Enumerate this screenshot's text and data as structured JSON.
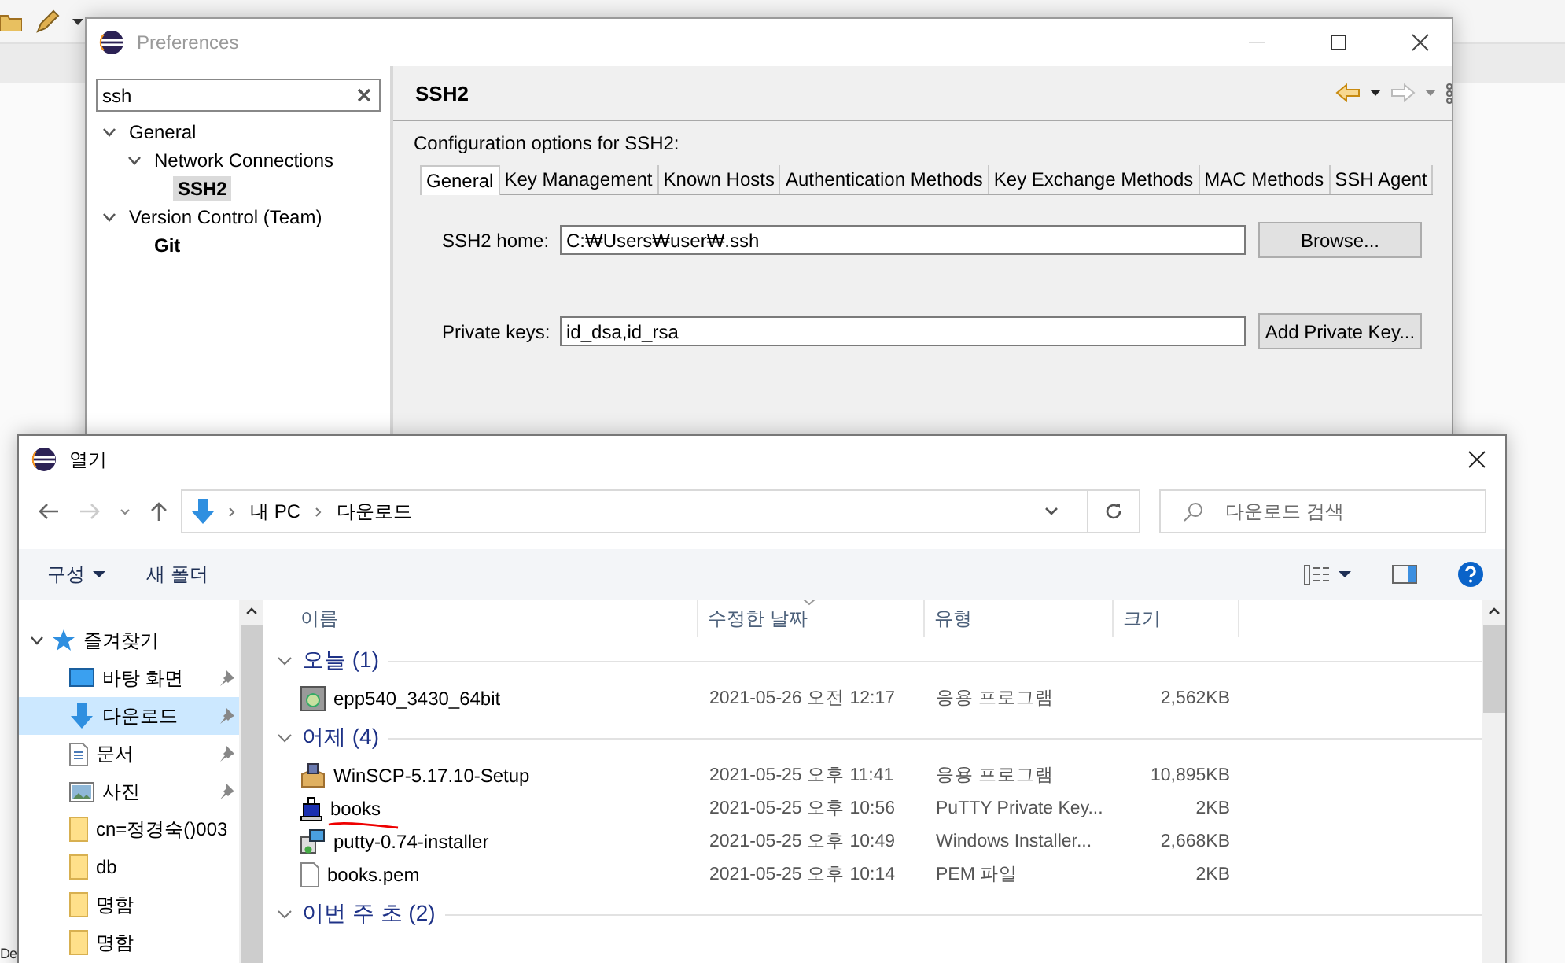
{
  "ide": {
    "status_text": "De"
  },
  "preferences": {
    "title": "Preferences",
    "filter": "ssh",
    "tree": [
      {
        "label": "General",
        "expanded": true,
        "match": false,
        "selected": false,
        "children": [
          {
            "label": "Network Connections",
            "expanded": true,
            "match": false,
            "selected": false,
            "children": [
              {
                "label": "SSH2",
                "match": true,
                "selected": true
              }
            ]
          }
        ]
      },
      {
        "label": "Version Control (Team)",
        "expanded": true,
        "match": false,
        "selected": false,
        "children": [
          {
            "label": "Git",
            "match": true,
            "selected": false
          }
        ]
      }
    ],
    "page_title": "SSH2",
    "description": "Configuration options for SSH2:",
    "tabs": [
      {
        "label": "General",
        "selected": true
      },
      {
        "label": "Key Management",
        "selected": false
      },
      {
        "label": "Known Hosts",
        "selected": false
      },
      {
        "label": "Authentication Methods",
        "selected": false
      },
      {
        "label": "Key Exchange Methods",
        "selected": false
      },
      {
        "label": "MAC Methods",
        "selected": false
      },
      {
        "label": "SSH Agent",
        "selected": false
      }
    ],
    "fields": [
      {
        "label": "SSH2 home:",
        "value": "C:₩Users₩user₩.ssh",
        "button": "Browse..."
      },
      {
        "label": "Private keys:",
        "value": "id_dsa,id_rsa",
        "button": "Add Private Key..."
      }
    ]
  },
  "open_dialog": {
    "title": "열기",
    "breadcrumb": [
      "내 PC",
      "다운로드"
    ],
    "search_placeholder": "다운로드 검색",
    "organize": "구성",
    "new_folder": "새 폴더",
    "nav": [
      {
        "label": "즐겨찾기",
        "kind": "favorites",
        "pinned": false,
        "selected": false
      },
      {
        "label": "바탕 화면",
        "kind": "desktop",
        "pinned": true,
        "selected": false
      },
      {
        "label": "다운로드",
        "kind": "download",
        "pinned": true,
        "selected": true
      },
      {
        "label": "문서",
        "kind": "document",
        "pinned": true,
        "selected": false
      },
      {
        "label": "사진",
        "kind": "pictures",
        "pinned": true,
        "selected": false
      },
      {
        "label": "cn=정경숙()003",
        "kind": "folder",
        "pinned": false,
        "selected": false
      },
      {
        "label": "db",
        "kind": "folder",
        "pinned": false,
        "selected": false
      },
      {
        "label": "명함",
        "kind": "folder",
        "pinned": false,
        "selected": false
      },
      {
        "label": "명함",
        "kind": "folder",
        "pinned": false,
        "selected": false
      }
    ],
    "columns": [
      {
        "label": "이름",
        "sorted": false
      },
      {
        "label": "수정한 날짜",
        "sorted": true
      },
      {
        "label": "유형",
        "sorted": false
      },
      {
        "label": "크기",
        "sorted": false
      }
    ],
    "groups": [
      {
        "label": "오늘 (1)",
        "files": [
          {
            "name": "epp540_3430_64bit",
            "modified": "2021-05-26 오전 12:17",
            "type": "응용 프로그램",
            "size": "2,562KB",
            "kind": "setup"
          }
        ]
      },
      {
        "label": "어제 (4)",
        "files": [
          {
            "name": "WinSCP-5.17.10-Setup",
            "modified": "2021-05-25 오후 11:41",
            "type": "응용 프로그램",
            "size": "10,895KB",
            "kind": "package"
          },
          {
            "name": "books",
            "modified": "2021-05-25 오후 10:56",
            "type": "PuTTY Private Key...",
            "size": "2KB",
            "kind": "key"
          },
          {
            "name": "putty-0.74-installer",
            "modified": "2021-05-25 오후 10:49",
            "type": "Windows Installer...",
            "size": "2,668KB",
            "kind": "msi"
          },
          {
            "name": "books.pem",
            "modified": "2021-05-25 오후 10:14",
            "type": "PEM 파일",
            "size": "2KB",
            "kind": "file"
          }
        ]
      },
      {
        "label": "이번 주 초 (2)"
      }
    ]
  }
}
